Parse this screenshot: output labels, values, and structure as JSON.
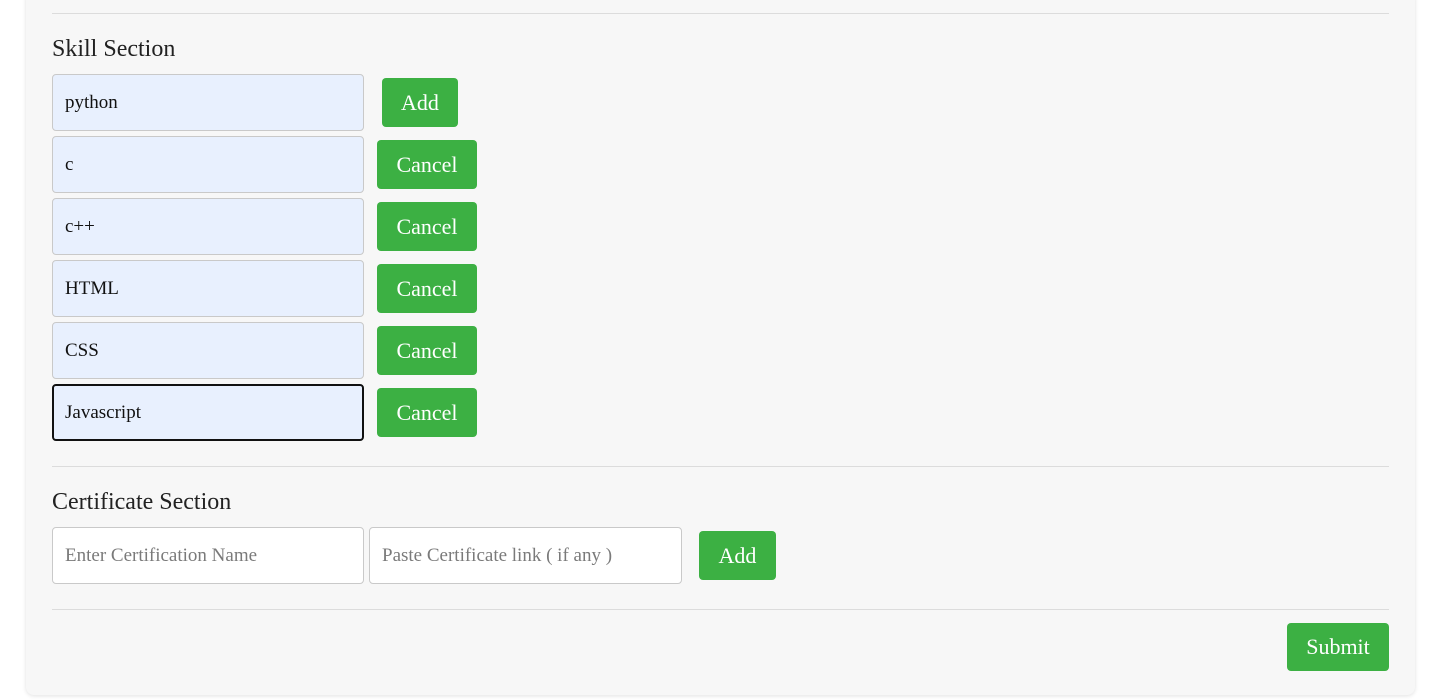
{
  "skill_section": {
    "title": "Skill Section",
    "new_skill": {
      "value": "python",
      "add_label": "Add"
    },
    "skills": [
      {
        "value": "c",
        "cancel_label": "Cancel"
      },
      {
        "value": "c++",
        "cancel_label": "Cancel"
      },
      {
        "value": "HTML",
        "cancel_label": "Cancel"
      },
      {
        "value": "CSS",
        "cancel_label": "Cancel"
      },
      {
        "value": "Javascript",
        "cancel_label": "Cancel"
      }
    ]
  },
  "certificate_section": {
    "title": "Certificate Section",
    "name_placeholder": "Enter Certification Name",
    "link_placeholder": "Paste Certificate link ( if any )",
    "add_label": "Add"
  },
  "form": {
    "submit_label": "Submit"
  },
  "colors": {
    "button_green": "#3cb043",
    "card_background": "#f7f7f7",
    "autofill_blue": "#e8f0fe"
  }
}
